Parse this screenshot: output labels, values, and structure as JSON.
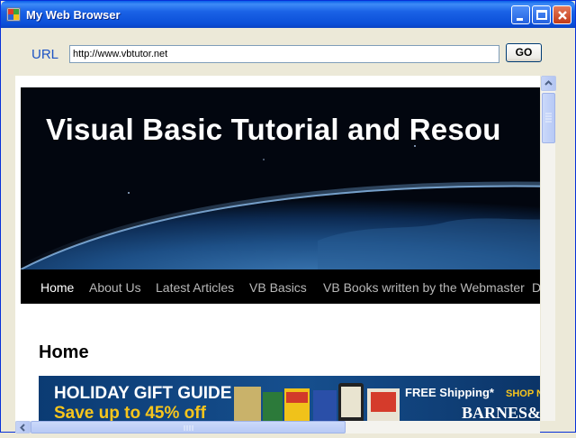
{
  "window": {
    "title": "My Web Browser"
  },
  "address_bar": {
    "label": "URL",
    "value": "http://www.vbtutor.net",
    "go_label": "GO"
  },
  "page": {
    "site_title": "Visual Basic Tutorial and Resou",
    "nav": [
      "Home",
      "About Us",
      "Latest Articles",
      "VB Basics",
      "VB Books written by the Webmaster",
      "D"
    ],
    "active_nav": "Home",
    "heading": "Home",
    "ad": {
      "line1": "HOLIDAY GIFT GUIDE",
      "line2": "Save up to 45% off",
      "shipping": "FREE Shipping*",
      "shop": "SHOP N",
      "brand": "BARNES&NO"
    }
  },
  "colors": {
    "titlebar": "#0a53dc",
    "url_label": "#1e54c4",
    "navbar": "#000000",
    "ad_yellow": "#f7c51c"
  }
}
